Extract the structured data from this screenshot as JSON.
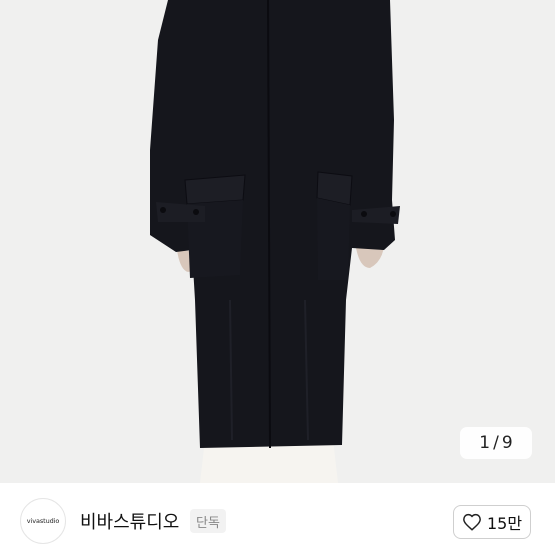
{
  "image_counter": {
    "current": "1",
    "separator": "/",
    "total": "9"
  },
  "seller": {
    "avatar_text": "vivastudio",
    "name": "비바스튜디오",
    "badge": "단독"
  },
  "like": {
    "icon": "heart-outline-icon",
    "count": "15만"
  },
  "colors": {
    "coat": "#15161c",
    "background": "#f0f0ef"
  }
}
